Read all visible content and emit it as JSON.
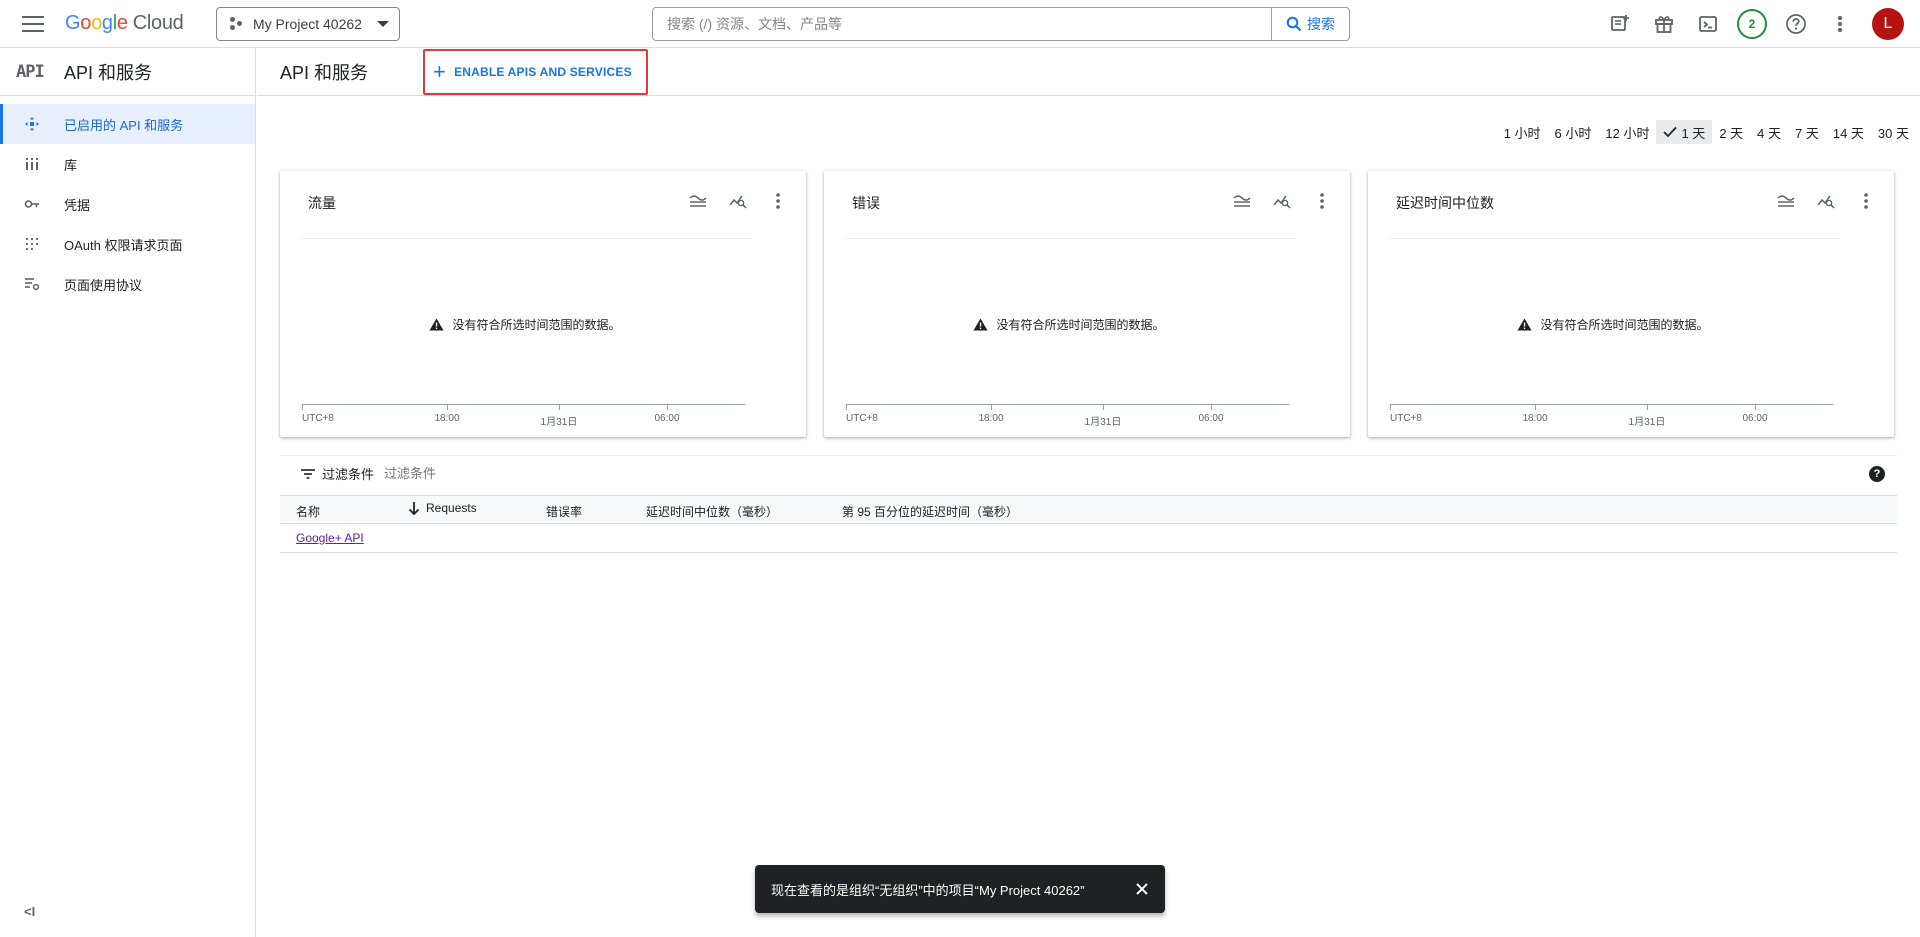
{
  "topbar": {
    "logo_google": [
      "G",
      "o",
      "o",
      "g",
      "l",
      "e"
    ],
    "logo_cloud": "Cloud",
    "project_name": "My Project 40262",
    "search_placeholder": "搜索 (/) 资源、文档、产品等",
    "search_button": "搜索",
    "notification_count": "2",
    "avatar_letter": "L",
    "icons": [
      "notes-add-icon",
      "gift-icon",
      "terminal-icon",
      "help-icon",
      "more-vert-icon"
    ]
  },
  "sidebar": {
    "logo": "API",
    "title": "API 和服务",
    "items": [
      {
        "label": "已启用的 API 和服务",
        "icon": "apis-icon",
        "active": true
      },
      {
        "label": "库",
        "icon": "library-icon",
        "active": false
      },
      {
        "label": "凭据",
        "icon": "key-icon",
        "active": false
      },
      {
        "label": "OAuth 权限请求页面",
        "icon": "oauth-icon",
        "active": false
      },
      {
        "label": "页面使用协议",
        "icon": "settings-list-icon",
        "active": false
      }
    ],
    "collapse_label": "<I"
  },
  "main": {
    "title": "API 和服务",
    "enable_button": "ENABLE APIS AND SERVICES",
    "time_ranges": [
      {
        "label": "1 小时",
        "selected": false
      },
      {
        "label": "6 小时",
        "selected": false
      },
      {
        "label": "12 小时",
        "selected": false
      },
      {
        "label": "1 天",
        "selected": true
      },
      {
        "label": "2 天",
        "selected": false
      },
      {
        "label": "4 天",
        "selected": false
      },
      {
        "label": "7 天",
        "selected": false
      },
      {
        "label": "14 天",
        "selected": false
      },
      {
        "label": "30 天",
        "selected": false
      }
    ],
    "cards": [
      {
        "title": "流量",
        "no_data": "没有符合所选时间范围的数据。"
      },
      {
        "title": "错误",
        "no_data": "没有符合所选时间范围的数据。"
      },
      {
        "title": "延迟时间中位数",
        "no_data": "没有符合所选时间范围的数据。"
      }
    ],
    "axis_labels": [
      "UTC+8",
      "18:00",
      "1月31日",
      "06:00"
    ],
    "filter": {
      "label": "过滤条件",
      "placeholder": "过滤条件"
    },
    "table": {
      "columns": [
        "名称",
        "Requests",
        "错误率",
        "延迟时间中位数（毫秒）",
        "第 95 百分位的延迟时间（毫秒）"
      ],
      "rows": [
        {
          "name": "Google+ API"
        }
      ]
    }
  },
  "snackbar": {
    "message": "现在查看的是组织“无组织”中的项目“My Project 40262”"
  },
  "colors": {
    "accent": "#1a73e8",
    "highlight_border": "#e53935",
    "avatar": "#b31412",
    "badge": "#1e8e3e"
  }
}
